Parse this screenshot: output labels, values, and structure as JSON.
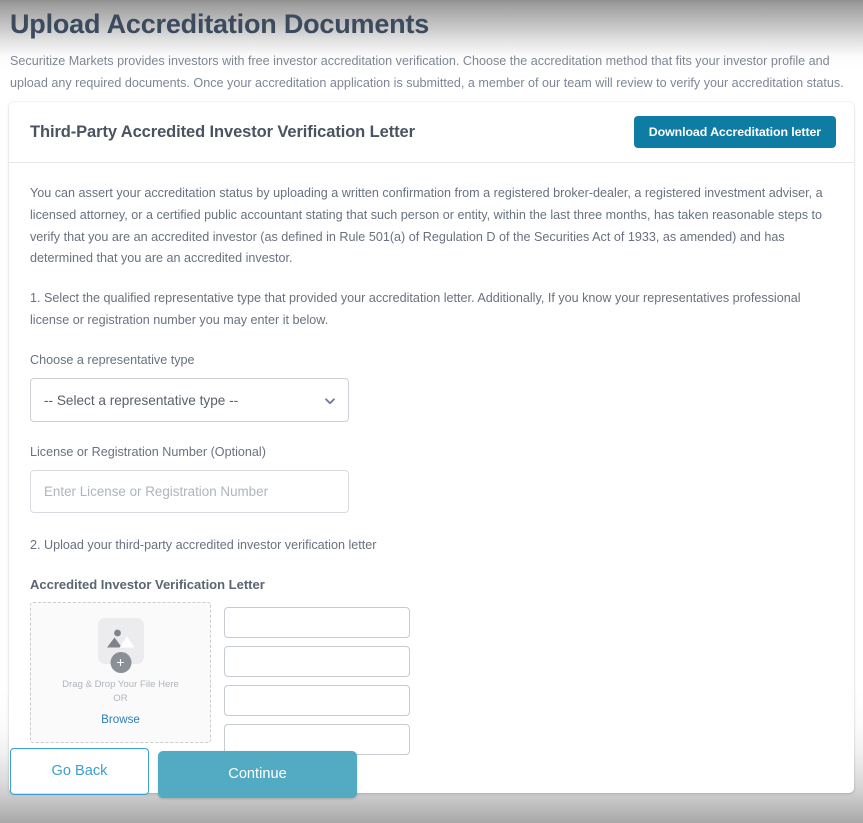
{
  "header": {
    "title": "Upload Accreditation Documents",
    "intro": "Securitize Markets provides investors with free investor accreditation verification. Choose the accreditation method that fits your investor profile and upload any required documents. Once your accreditation application is submitted, a member of our team will review to verify your accreditation status."
  },
  "card": {
    "title": "Third-Party Accredited Investor Verification Letter",
    "download_button": "Download Accreditation letter",
    "intro_paragraph": "You can assert your accreditation status by uploading a written confirmation from a registered broker-dealer, a registered investment adviser, a licensed attorney, or a certified public accountant stating that such person or entity, within the last three months, has taken reasonable steps to verify that you are an accredited investor (as defined in Rule 501(a) of Regulation D of the Securities Act of 1933, as amended) and has determined that you are an accredited investor.",
    "step_one": "1. Select the qualified representative type that provided your accreditation letter. Additionally, If you know your representatives professional license or registration number you may enter it below.",
    "representative": {
      "label": "Choose a representative type",
      "selected": "-- Select a representative type --",
      "chevron_icon": "chevron-down-icon"
    },
    "license": {
      "label": "License or Registration Number (Optional)",
      "value": "",
      "placeholder": "Enter License or Registration Number"
    },
    "step_two": "2. Upload your third-party accredited investor verification letter",
    "upload": {
      "label": "Accredited Investor Verification Letter",
      "icon": "image-placeholder-icon",
      "badge_icon": "plus-icon",
      "badge_glyph": "+",
      "drag_text": "Drag & Drop Your File Here",
      "or_text": "OR",
      "browse_label": "Browse",
      "meta_fields": [
        {
          "name": "upload-field-1",
          "value": "",
          "placeholder": ""
        },
        {
          "name": "upload-field-2",
          "value": "",
          "placeholder": ""
        },
        {
          "name": "upload-field-3",
          "value": "",
          "placeholder": ""
        },
        {
          "name": "upload-field-4",
          "value": "",
          "placeholder": ""
        }
      ]
    }
  },
  "footer": {
    "back_label": "Go Back",
    "continue_label": "Continue"
  },
  "colors": {
    "accent_teal": "#0f7da3",
    "continue_blue": "#52aac3",
    "link_blue": "#2a7fb8",
    "title_slate": "#3c4a5e",
    "body_grey": "#68727f"
  }
}
